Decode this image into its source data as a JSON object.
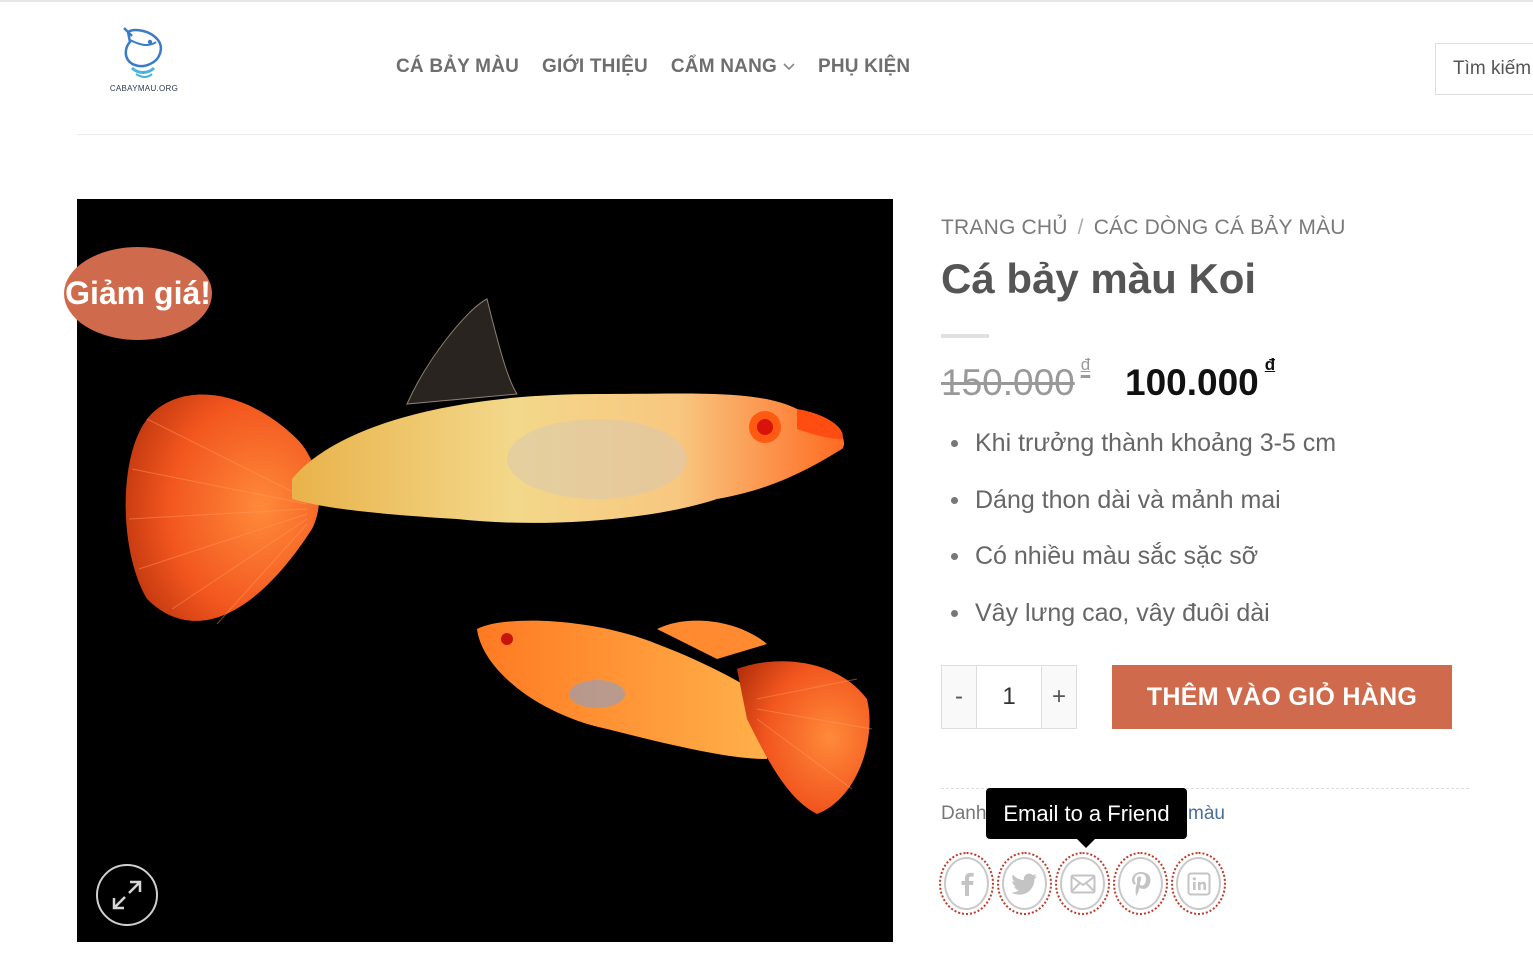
{
  "header": {
    "logo_text": "CABAYMAU.ORG",
    "nav": [
      {
        "label": "CÁ BẢY MÀU"
      },
      {
        "label": "GIỚI THIỆU"
      },
      {
        "label": "CẨM NANG",
        "has_dropdown": true
      },
      {
        "label": "PHỤ KIỆN"
      }
    ],
    "search_placeholder": "Tìm kiếm"
  },
  "product": {
    "sale_badge": "Giảm giá!",
    "breadcrumb": [
      "TRANG CHỦ",
      "CÁC DÒNG CÁ BẢY MÀU"
    ],
    "breadcrumb_sep": "/",
    "title": "Cá bảy màu Koi",
    "price_old": "150.000",
    "price_new": "100.000",
    "currency": "đ",
    "features": [
      "Khi trưởng thành khoảng 3-5 cm",
      "Dáng thon dài và mảnh mai",
      "Có nhiều màu sắc sặc sỡ",
      "Vây lưng cao, vây đuôi dài"
    ],
    "qty_minus": "-",
    "qty_value": "1",
    "qty_plus": "+",
    "add_to_cart": "THÊM VÀO GIỎ HÀNG",
    "meta_prefix": "Danh",
    "meta_link_suffix": "màu",
    "tooltip": "Email to a Friend",
    "share": [
      "facebook-icon",
      "twitter-icon",
      "email-icon",
      "pinterest-icon",
      "linkedin-icon"
    ]
  },
  "colors": {
    "accent": "#cf6b4c",
    "link": "#4a6d9c",
    "text": "#555555"
  }
}
